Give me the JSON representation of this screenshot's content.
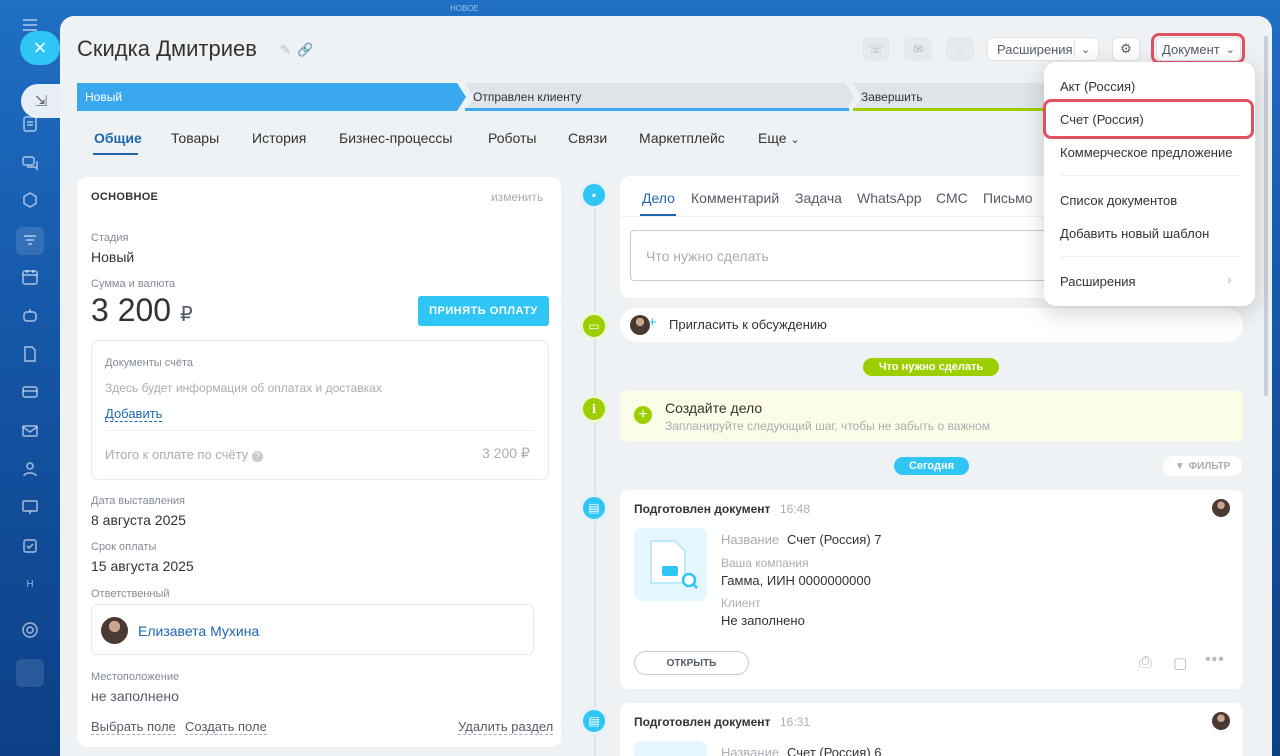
{
  "window": {
    "title": "Скидка Дмитриев",
    "top_hint": "НОВОЕ"
  },
  "header": {
    "extensions_label": "Расширения",
    "document_label": "Документ"
  },
  "stages": [
    {
      "label": "Новый",
      "color": "#39a8ef"
    },
    {
      "label": "Отправлен клиенту",
      "color": "#cfd6dc"
    },
    {
      "label": "Завершить",
      "color": "#cfd6dc"
    }
  ],
  "tabs": [
    "Общие",
    "Товары",
    "История",
    "Бизнес-процессы",
    "Роботы",
    "Связи",
    "Маркетплейс",
    "Еще"
  ],
  "main_card": {
    "section_title": "ОСНОВНОЕ",
    "edit_label": "изменить",
    "stage_label": "Стадия",
    "stage_value": "Новый",
    "amount_label": "Сумма и валюта",
    "amount_value": "3 200",
    "currency": "₽",
    "pay_button": "ПРИНЯТЬ ОПЛАТУ",
    "invoice_docs_label": "Документы счёта",
    "invoice_info": "Здесь будет информация об оплатах и доставках",
    "add_link": "Добавить",
    "total_label": "Итого к оплате по счёту",
    "total_value": "3 200 ₽",
    "issue_date_label": "Дата выставления",
    "issue_date_value": "8 августа 2025",
    "due_date_label": "Срок оплаты",
    "due_date_value": "15 августа 2025",
    "responsible_label": "Ответственный",
    "responsible_name": "Елизавета Мухина",
    "location_label": "Местоположение",
    "location_value": "не заполнено",
    "choose_field": "Выбрать поле",
    "create_field": "Создать поле",
    "delete_section": "Удалить раздел"
  },
  "timeline": {
    "tabs": [
      "Дело",
      "Комментарий",
      "Задача",
      "WhatsApp",
      "СМС",
      "Письмо"
    ],
    "todo_placeholder": "Что нужно сделать",
    "invite_label": "Пригласить к обсуждению",
    "todo_pill": "Что нужно сделать",
    "create_task_title": "Создайте дело",
    "create_task_hint": "Запланируйте следующий шаг, чтобы не забыть о важном",
    "today_pill": "Сегодня",
    "filter_label": "ФИЛЬТР",
    "entries": [
      {
        "title": "Подготовлен документ",
        "time": "16:48",
        "name_label": "Название",
        "name_value": "Счет (Россия) 7",
        "company_label": "Ваша компания",
        "company_value": "Гамма, ИИН 0000000000",
        "client_label": "Клиент",
        "client_value": "Не заполнено",
        "open_button": "ОТКРЫТЬ"
      },
      {
        "title": "Подготовлен документ",
        "time": "16:31",
        "name_label": "Название",
        "name_value": "Счет (Россия) 6"
      }
    ]
  },
  "document_menu": {
    "items": [
      "Акт (Россия)",
      "Счет (Россия)",
      "Коммерческое предложение",
      "Список документов",
      "Добавить новый шаблон",
      "Расширения"
    ]
  },
  "colors": {
    "accent": "#2fc6f6",
    "link": "#2067b0",
    "highlight": "#e0525f",
    "green": "#9dcf00"
  }
}
